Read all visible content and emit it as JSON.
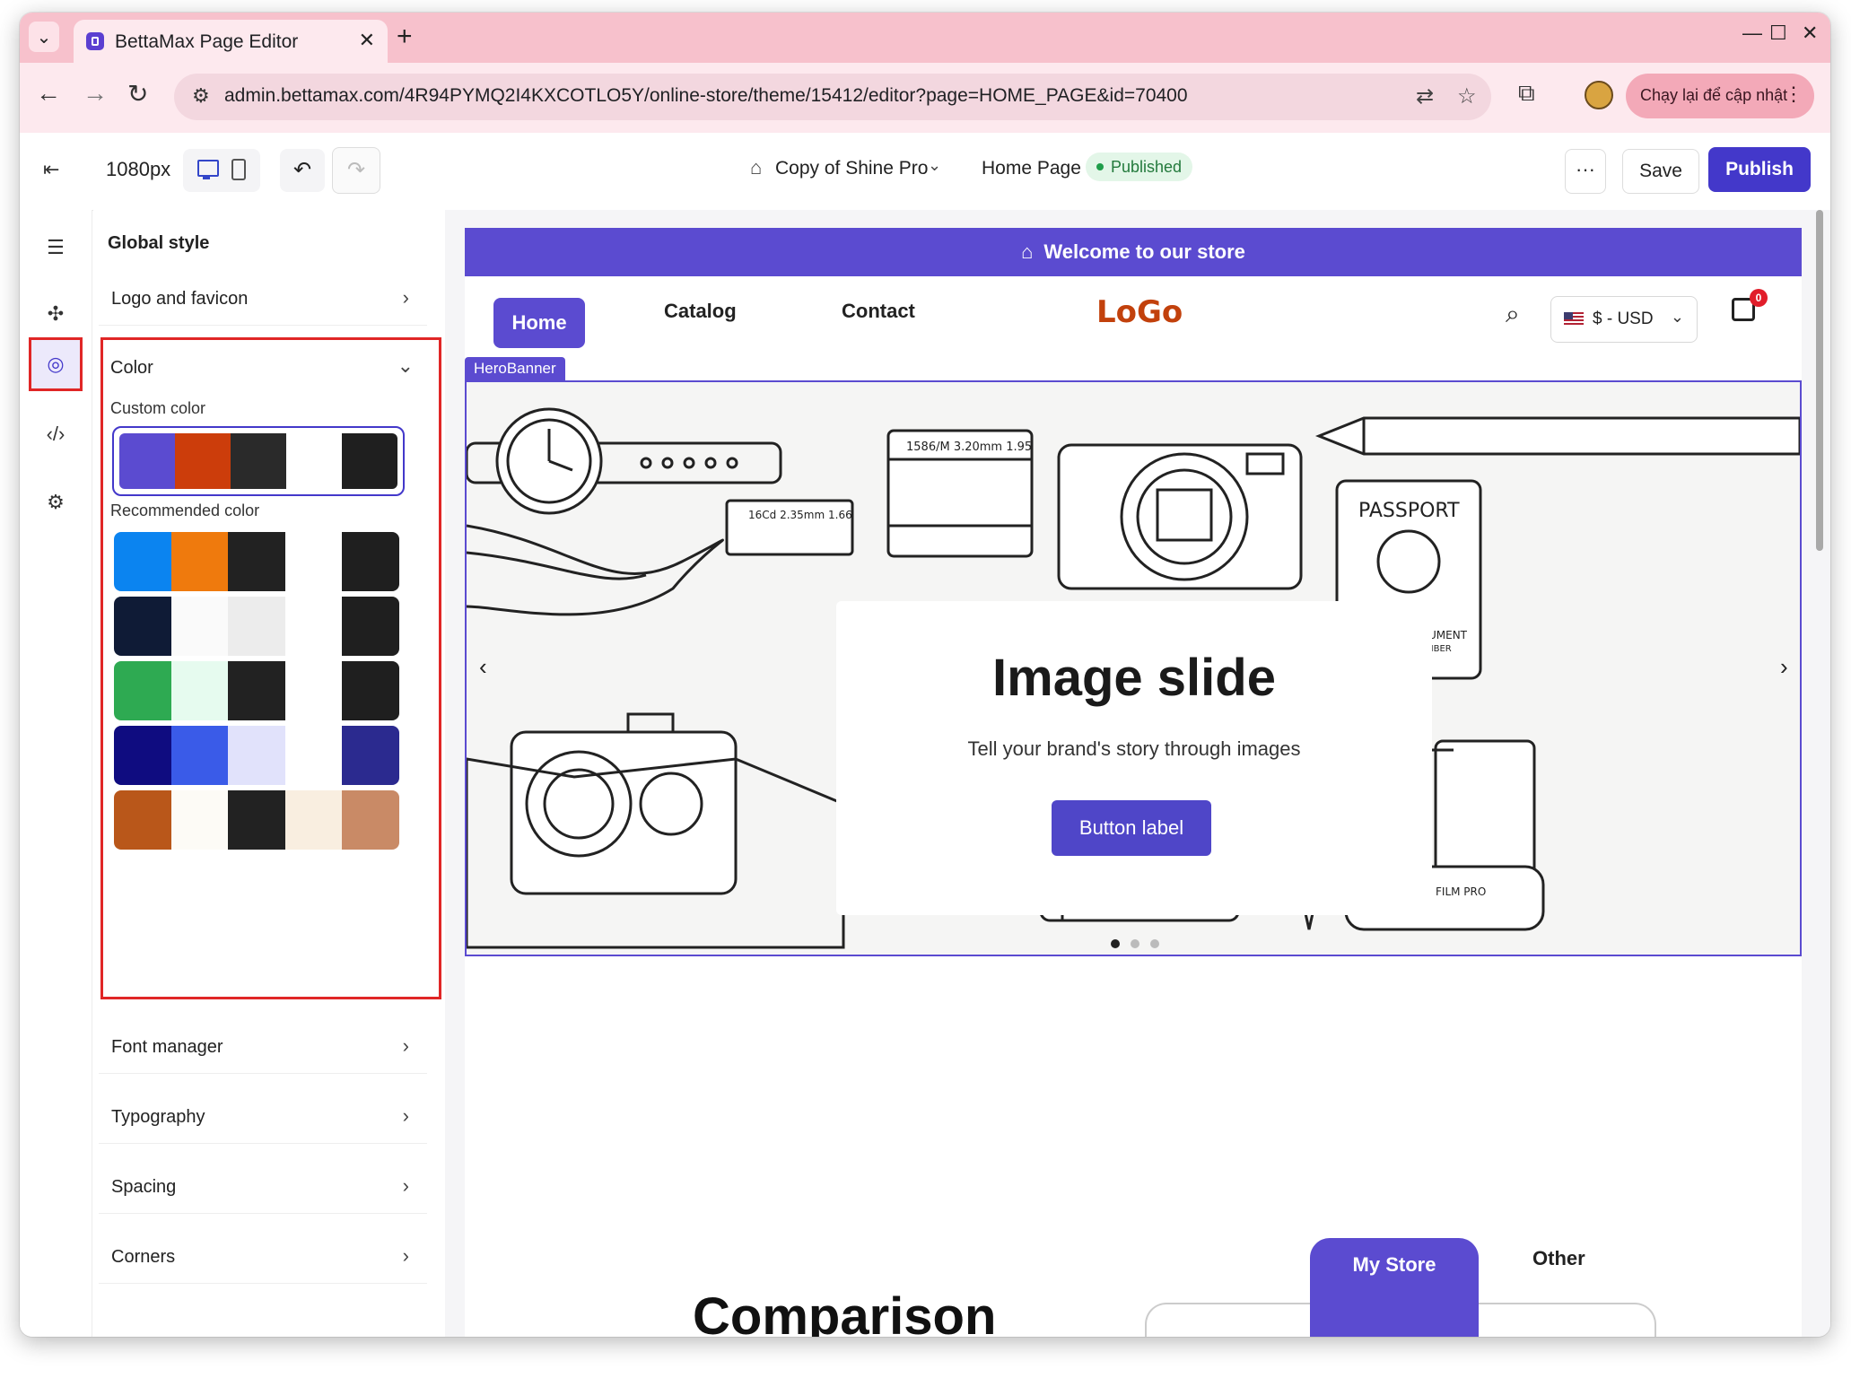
{
  "browser": {
    "tab_title": "BettaMax Page Editor",
    "url": "admin.bettamax.com/4R94PYMQ2I4KXCOTLO5Y/online-store/theme/15412/editor?page=HOME_PAGE&id=70400",
    "update_label": "Chạy lại để cập nhật"
  },
  "topbar": {
    "width_label": "1080px",
    "theme_name": "Copy of Shine Pro",
    "page_name": "Home Page",
    "status": "Published",
    "more_label": "···",
    "save_label": "Save",
    "publish_label": "Publish"
  },
  "panel": {
    "title": "Global style",
    "logo_row": "Logo and favicon",
    "color_heading": "Color",
    "custom_color_label": "Custom color",
    "recommended_label": "Recommended color",
    "custom_palette": [
      "#5b4bd0",
      "#cc3d0b",
      "#2a2a2a",
      "#ffffff",
      "#1f1f1f"
    ],
    "recommended_palettes": [
      [
        "#0b84f0",
        "#ef7a0d",
        "#222222",
        "#ffffff",
        "#1f1f1f"
      ],
      [
        "#0f1b36",
        "#fafafa",
        "#ececec",
        "#ffffff",
        "#1f1f1f"
      ],
      [
        "#2eaa52",
        "#e6fbef",
        "#222222",
        "#ffffff",
        "#1f1f1f"
      ],
      [
        "#0f0c80",
        "#3a5be8",
        "#e1e2fb",
        "#ffffff",
        "#2b2a8f"
      ],
      [
        "#b9571a",
        "#fdfbf6",
        "#222222",
        "#f9eee0",
        "#c98a66"
      ]
    ],
    "rows_after": [
      "Font manager",
      "Typography",
      "Spacing",
      "Corners"
    ]
  },
  "store": {
    "announcement": "Welcome to our store",
    "nav": {
      "home": "Home",
      "catalog": "Catalog",
      "contact": "Contact",
      "logo": "LoGo",
      "currency": "$ - USD",
      "cart_count": "0"
    },
    "hero_tag": "HeroBanner",
    "hero_title": "Image slide",
    "hero_subtitle": "Tell your brand's story through images",
    "hero_button": "Button label",
    "hero_illustration_labels": {
      "lens1": "1586/M  3.20mm  1.95",
      "lens2": "16Cd  2.35mm  1.66",
      "passport": "PASSPORT",
      "travel_doc": "TRAVEL DOCUMENT",
      "serial": "SERIAL NUMBER",
      "film": "FILM PRO"
    },
    "comparison_title": "Comparison",
    "tab_mystore": "My Store",
    "tab_other": "Other"
  }
}
